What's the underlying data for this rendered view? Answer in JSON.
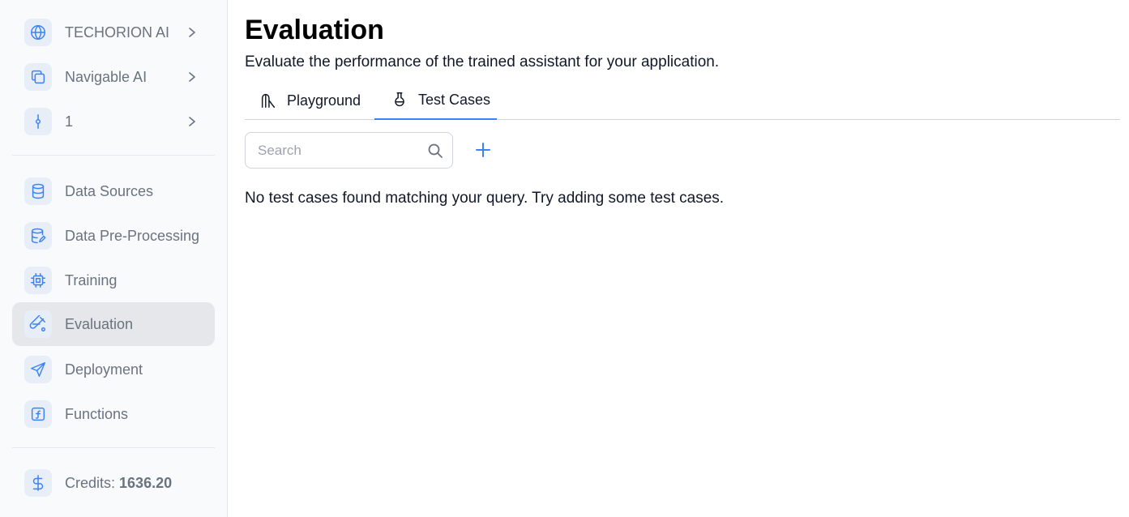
{
  "sidebar": {
    "org": {
      "label": "TECHORION AI",
      "icon": "globe-icon"
    },
    "project": {
      "label": "Navigable AI",
      "icon": "copy-icon"
    },
    "version": {
      "label": "1",
      "icon": "git-commit-icon"
    },
    "items": [
      {
        "label": "Data Sources",
        "icon": "database-icon"
      },
      {
        "label": "Data Pre-Processing",
        "icon": "database-edit-icon"
      },
      {
        "label": "Training",
        "icon": "cpu-icon"
      },
      {
        "label": "Evaluation",
        "icon": "flask-icon",
        "active": true
      },
      {
        "label": "Deployment",
        "icon": "send-icon"
      },
      {
        "label": "Functions",
        "icon": "function-icon"
      }
    ],
    "credits": {
      "prefix": "Credits: ",
      "value": "1636.20",
      "icon": "dollar-icon"
    }
  },
  "main": {
    "title": "Evaluation",
    "subtitle": "Evaluate the performance of the trained assistant for your application.",
    "tabs": [
      {
        "label": "Playground",
        "icon": "playground-icon",
        "active": false
      },
      {
        "label": "Test Cases",
        "icon": "beaker-icon",
        "active": true
      }
    ],
    "search": {
      "placeholder": "Search",
      "value": ""
    },
    "empty_message": "No test cases found matching your query. Try adding some test cases."
  },
  "colors": {
    "accent": "#3b82f6",
    "sidebar_bg": "#f9fafb",
    "active_item_bg": "#e5e7eb",
    "muted_text": "#6b7280"
  }
}
